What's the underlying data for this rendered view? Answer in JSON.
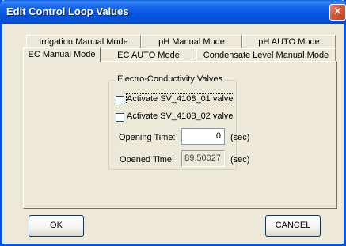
{
  "window": {
    "title": "Edit Control Loop Values",
    "close_glyph": "✕"
  },
  "tabs": {
    "back_row": [
      {
        "label": "Irrigation Manual Mode"
      },
      {
        "label": "pH Manual Mode"
      },
      {
        "label": "pH AUTO Mode"
      }
    ],
    "front_row": [
      {
        "label": "EC Manual Mode",
        "active": true
      },
      {
        "label": "EC AUTO Mode"
      },
      {
        "label": "Condensate Level Manual Mode"
      }
    ]
  },
  "group": {
    "label": "Electro-Conductivity Valves",
    "checkboxes": [
      {
        "label": "Activate SV_4108_01 valve",
        "checked": false
      },
      {
        "label": "Activate SV_4108_02 valve",
        "checked": false
      }
    ],
    "opening_time": {
      "label": "Opening Time:",
      "value": "0",
      "unit": "(sec)"
    },
    "opened_time": {
      "label": "Opened Time:",
      "value": "89.50027",
      "unit": "(sec)"
    }
  },
  "buttons": {
    "ok": "OK",
    "cancel": "CANCEL"
  }
}
